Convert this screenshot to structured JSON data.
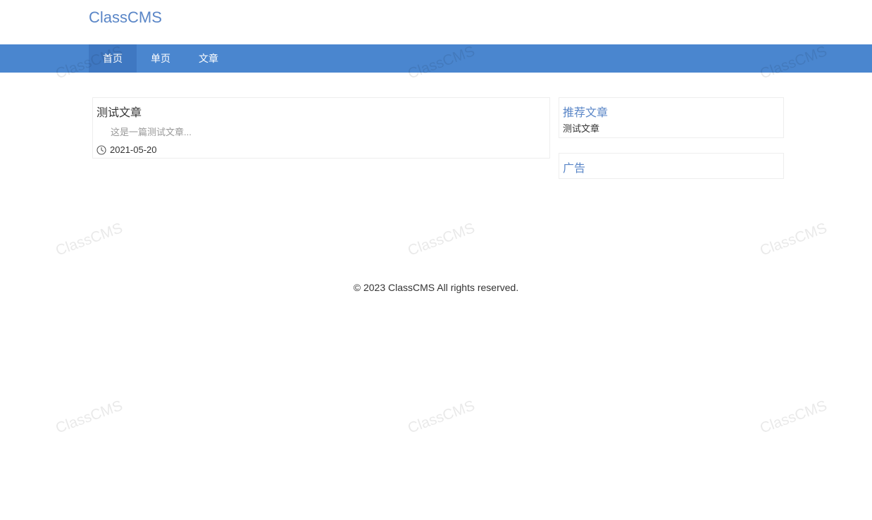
{
  "header": {
    "site_name": "ClassCMS"
  },
  "nav": {
    "items": [
      {
        "label": "首页",
        "active": true
      },
      {
        "label": "单页",
        "active": false
      },
      {
        "label": "文章",
        "active": false
      }
    ]
  },
  "articles": [
    {
      "title": "测试文章",
      "excerpt": "这是一篇测试文章...",
      "date": "2021-05-20",
      "date_icon": "clock-icon"
    }
  ],
  "sidebar": {
    "recommend": {
      "title": "推荐文章",
      "items": [
        "测试文章"
      ]
    },
    "ads": {
      "title": "广告"
    }
  },
  "footer": {
    "prefix": "© 2023 ",
    "brand": "ClassCMS",
    "suffix": " All rights reserved."
  },
  "watermark": {
    "text": "ClassCMS"
  },
  "colors": {
    "brand": "#5a86c7",
    "nav_bg": "#4a86cf",
    "nav_active_bg": "#3f78c2",
    "excerpt": "#999999"
  }
}
